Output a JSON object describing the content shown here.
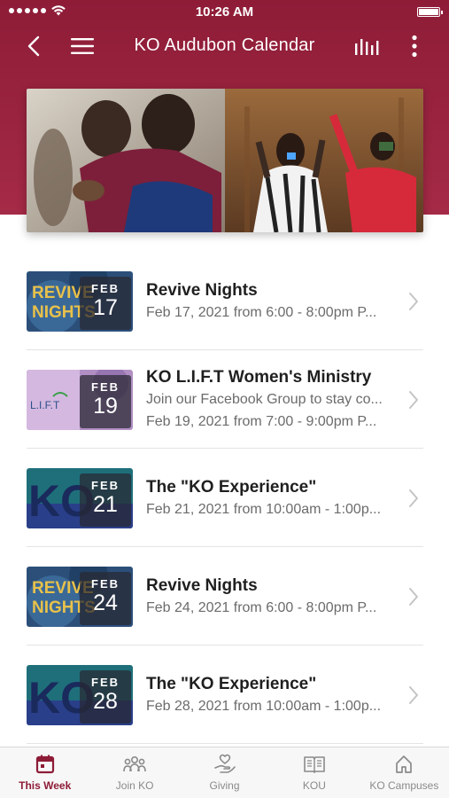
{
  "status_bar": {
    "time": "10:26 AM"
  },
  "nav": {
    "title": "KO Audubon Calendar"
  },
  "colors": {
    "brand": "#8e1c37",
    "text_primary": "#1f1f1f",
    "text_secondary": "#6b6b6b",
    "tab_inactive": "#8a8a8a"
  },
  "events": [
    {
      "thumb": "revive",
      "month": "FEB",
      "day": "17",
      "title": "Revive Nights",
      "lines": [
        "Feb 17, 2021 from 6:00 - 8:00pm P..."
      ]
    },
    {
      "thumb": "lift",
      "month": "FEB",
      "day": "19",
      "title": "KO L.I.F.T Women's Ministry",
      "lines": [
        "Join our Facebook Group to stay co...",
        "Feb 19, 2021 from 7:00 - 9:00pm P..."
      ]
    },
    {
      "thumb": "ko",
      "month": "FEB",
      "day": "21",
      "title": "The \"KO Experience\"",
      "lines": [
        "Feb 21, 2021 from 10:00am - 1:00p..."
      ]
    },
    {
      "thumb": "revive",
      "month": "FEB",
      "day": "24",
      "title": "Revive Nights",
      "lines": [
        "Feb 24, 2021 from 6:00 - 8:00pm P..."
      ]
    },
    {
      "thumb": "ko",
      "month": "FEB",
      "day": "28",
      "title": "The \"KO Experience\"",
      "lines": [
        "Feb 28, 2021 from 10:00am - 1:00p..."
      ]
    }
  ],
  "thumb_text": {
    "revive_a": "REVIVE",
    "revive_b": "NIGHTS",
    "lift": "L.I.F.T",
    "ko": "KO"
  },
  "tabs": [
    {
      "label": "This Week",
      "icon": "calendar-icon",
      "active": true
    },
    {
      "label": "Join KO",
      "icon": "group-icon",
      "active": false
    },
    {
      "label": "Giving",
      "icon": "giving-hand-icon",
      "active": false
    },
    {
      "label": "KOU",
      "icon": "book-icon",
      "active": false
    },
    {
      "label": "KO Campuses",
      "icon": "home-icon",
      "active": false
    }
  ]
}
